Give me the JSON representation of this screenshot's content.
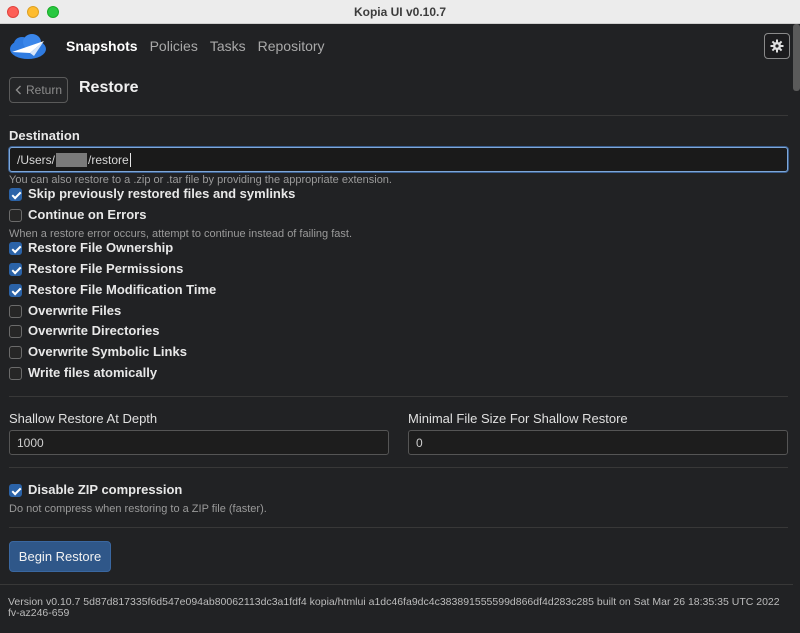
{
  "window": {
    "title": "Kopia UI v0.10.7"
  },
  "nav": {
    "links": [
      {
        "label": "Snapshots",
        "active": true
      },
      {
        "label": "Policies",
        "active": false
      },
      {
        "label": "Tasks",
        "active": false
      },
      {
        "label": "Repository",
        "active": false
      }
    ]
  },
  "header": {
    "return_label": "Return",
    "title": "Restore"
  },
  "destination": {
    "label": "Destination",
    "value_prefix": "/Users/",
    "value_suffix": "/restore",
    "help": "You can also restore to a .zip or .tar file by providing the appropriate extension."
  },
  "options": [
    {
      "label": "Skip previously restored files and symlinks",
      "checked": true
    },
    {
      "label": "Continue on Errors",
      "checked": false,
      "help": "When a restore error occurs, attempt to continue instead of failing fast."
    },
    {
      "label": "Restore File Ownership",
      "checked": true
    },
    {
      "label": "Restore File Permissions",
      "checked": true
    },
    {
      "label": "Restore File Modification Time",
      "checked": true
    },
    {
      "label": "Overwrite Files",
      "checked": false
    },
    {
      "label": "Overwrite Directories",
      "checked": false
    },
    {
      "label": "Overwrite Symbolic Links",
      "checked": false
    },
    {
      "label": "Write files atomically",
      "checked": false
    }
  ],
  "shallow": {
    "depth_label": "Shallow Restore At Depth",
    "depth_value": "1000",
    "minsize_label": "Minimal File Size For Shallow Restore",
    "minsize_value": "0"
  },
  "zip": {
    "label": "Disable ZIP compression",
    "checked": true,
    "help": "Do not compress when restoring to a ZIP file (faster)."
  },
  "actions": {
    "begin_label": "Begin Restore"
  },
  "footer": {
    "version_text": "Version v0.10.7 5d87d817335f6d547e094ab80062113dc3a1fdf4 kopia/htmlui a1dc46fa9dc4c383891555599d866df4d283c285 built on Sat Mar 26 18:35:35 UTC 2022 fv-az246-659"
  },
  "colors": {
    "accent": "#2b63a8",
    "button": "#2f5789",
    "background": "#212224"
  }
}
